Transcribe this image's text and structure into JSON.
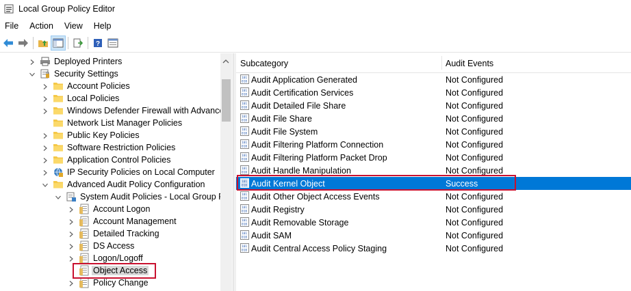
{
  "window": {
    "title": "Local Group Policy Editor"
  },
  "menu": [
    "File",
    "Action",
    "View",
    "Help"
  ],
  "toolbar": {
    "buttons": [
      "back-icon",
      "forward-icon",
      "up-folder-icon",
      "show-hide-tree-icon",
      "export-list-icon",
      "help-icon",
      "properties-icon"
    ]
  },
  "tree": [
    {
      "label": "Deployed Printers",
      "expand": "collapsed",
      "icon": "printer-icon"
    },
    {
      "label": "Security Settings",
      "expand": "expanded",
      "icon": "security-settings-icon"
    },
    {
      "label": "Account Policies",
      "expand": "collapsed",
      "icon": "folder-icon"
    },
    {
      "label": "Local Policies",
      "expand": "collapsed",
      "icon": "folder-icon"
    },
    {
      "label": "Windows Defender Firewall with Advanced",
      "expand": "collapsed",
      "icon": "folder-icon"
    },
    {
      "label": "Network List Manager Policies",
      "expand": "none",
      "icon": "folder-icon"
    },
    {
      "label": "Public Key Policies",
      "expand": "collapsed",
      "icon": "folder-icon"
    },
    {
      "label": "Software Restriction Policies",
      "expand": "collapsed",
      "icon": "folder-icon"
    },
    {
      "label": "Application Control Policies",
      "expand": "collapsed",
      "icon": "folder-icon"
    },
    {
      "label": "IP Security Policies on Local Computer",
      "expand": "collapsed",
      "icon": "ip-security-icon"
    },
    {
      "label": "Advanced Audit Policy Configuration",
      "expand": "expanded",
      "icon": "folder-icon"
    },
    {
      "label": "System Audit Policies - Local Group Pc",
      "expand": "expanded",
      "icon": "audit-policies-icon"
    },
    {
      "label": "Account Logon",
      "expand": "collapsed",
      "icon": "policy-category-icon"
    },
    {
      "label": "Account Management",
      "expand": "collapsed",
      "icon": "policy-category-icon"
    },
    {
      "label": "Detailed Tracking",
      "expand": "collapsed",
      "icon": "policy-category-icon"
    },
    {
      "label": "DS Access",
      "expand": "collapsed",
      "icon": "policy-category-icon"
    },
    {
      "label": "Logon/Logoff",
      "expand": "collapsed",
      "icon": "policy-category-icon"
    },
    {
      "label": "Object Access",
      "expand": "none",
      "icon": "policy-category-icon",
      "selected": true
    },
    {
      "label": "Policy Change",
      "expand": "collapsed",
      "icon": "policy-category-icon"
    }
  ],
  "list": {
    "columns": [
      "Subcategory",
      "Audit Events"
    ],
    "rows": [
      {
        "name": "Audit Application Generated",
        "value": "Not Configured"
      },
      {
        "name": "Audit Certification Services",
        "value": "Not Configured"
      },
      {
        "name": "Audit Detailed File Share",
        "value": "Not Configured"
      },
      {
        "name": "Audit File Share",
        "value": "Not Configured"
      },
      {
        "name": "Audit File System",
        "value": "Not Configured"
      },
      {
        "name": "Audit Filtering Platform Connection",
        "value": "Not Configured"
      },
      {
        "name": "Audit Filtering Platform Packet Drop",
        "value": "Not Configured"
      },
      {
        "name": "Audit Handle Manipulation",
        "value": "Not Configured"
      },
      {
        "name": "Audit Kernel Object",
        "value": "Success",
        "selected": true
      },
      {
        "name": "Audit Other Object Access Events",
        "value": "Not Configured"
      },
      {
        "name": "Audit Registry",
        "value": "Not Configured"
      },
      {
        "name": "Audit Removable Storage",
        "value": "Not Configured"
      },
      {
        "name": "Audit SAM",
        "value": "Not Configured"
      },
      {
        "name": "Audit Central Access Policy Staging",
        "value": "Not Configured"
      }
    ]
  },
  "colors": {
    "selection": "#0078d7",
    "highlight": "#c8102e",
    "tree_selected": "#d9d9d9"
  }
}
